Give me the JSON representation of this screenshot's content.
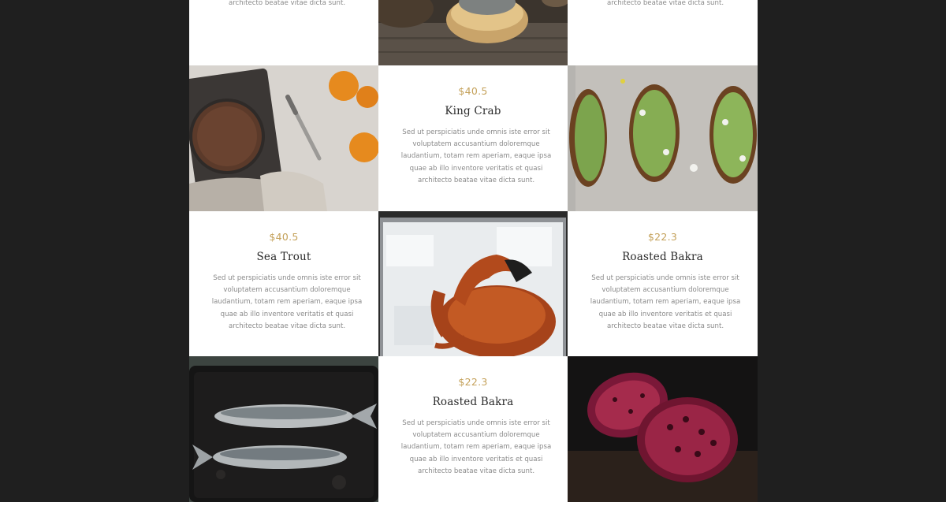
{
  "menu": {
    "items": [
      {
        "price": "",
        "title": "",
        "desc": "Sed ut perspiciatis unde omnis iste error sit voluptatem accusantium doloremque laudantium, totam rem aperiam, eaque ipsa quae ab illo inventore veritatis et quasi architecto beatae vitae dicta sunt."
      },
      {
        "price": "",
        "title": "",
        "desc": "Sed ut perspiciatis unde omnis iste error sit voluptatem accusantium doloremque laudantium, totam rem aperiam, eaque ipsa quae ab illo inventore veritatis et quasi architecto beatae vitae dicta sunt."
      },
      {
        "price": "$40.5",
        "title": "King Crab",
        "desc": "Sed ut perspiciatis unde omnis iste error sit voluptatem accusantium doloremque laudantium, totam rem aperiam, eaque ipsa quae ab illo inventore veritatis et quasi architecto beatae vitae dicta sunt."
      },
      {
        "price": "$40.5",
        "title": "Sea Trout",
        "desc": "Sed ut perspiciatis unde omnis iste error sit voluptatem accusantium doloremque laudantium, totam rem aperiam, eaque ipsa quae ab illo inventore veritatis et quasi architecto beatae vitae dicta sunt."
      },
      {
        "price": "$22.3",
        "title": "Roasted Bakra",
        "desc": "Sed ut perspiciatis unde omnis iste error sit voluptatem accusantium doloremque laudantium, totam rem aperiam, eaque ipsa quae ab illo inventore veritatis et quasi architecto beatae vitae dicta sunt."
      },
      {
        "price": "$22.3",
        "title": "Roasted Bakra",
        "desc": "Sed ut perspiciatis unde omnis iste error sit voluptatem accusantium doloremque laudantium, totam rem aperiam, eaque ipsa quae ab illo inventore veritatis et quasi architecto beatae vitae dicta sunt."
      }
    ]
  },
  "colors": {
    "background": "#1f1f1f",
    "card": "#ffffff",
    "price_accent": "#c4a15a",
    "title": "#2a2a2a",
    "text_muted": "#8a8a8a"
  },
  "icons": [
    "cheese-photo",
    "pie-oranges-photo",
    "toast-photo",
    "crab-photo",
    "fish-photo",
    "pomegranate-photo"
  ]
}
